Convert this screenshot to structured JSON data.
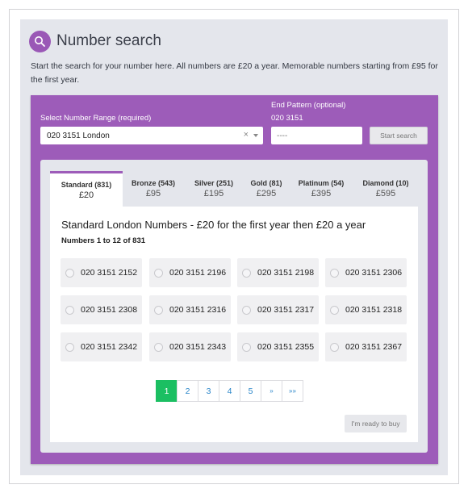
{
  "header": {
    "title": "Number search",
    "logo_icon": "magnifier-icon"
  },
  "intro": "Start the search for your number here. All numbers are £20 a year. Memorable numbers starting from £95 for the first year.",
  "search": {
    "range_label": "Select Number Range (required)",
    "range_value": "020 3151 London",
    "pattern_label": "End Pattern (optional)",
    "pattern_prefix": "020 3151",
    "pattern_placeholder": "----",
    "start_button": "Start search"
  },
  "tabs": [
    {
      "name": "Standard (831)",
      "price": "£20",
      "active": true
    },
    {
      "name": "Bronze (543)",
      "price": "£95"
    },
    {
      "name": "Silver (251)",
      "price": "£195"
    },
    {
      "name": "Gold (81)",
      "price": "£295"
    },
    {
      "name": "Platinum (54)",
      "price": "£395"
    },
    {
      "name": "Diamond (10)",
      "price": "£595"
    }
  ],
  "results": {
    "title": "Standard London Numbers - £20 for the first year then £20 a year",
    "subtitle": "Numbers 1 to 12 of 831",
    "numbers": [
      "020 3151 2152",
      "020 3151 2196",
      "020 3151 2198",
      "020 3151 2306",
      "020 3151 2308",
      "020 3151 2316",
      "020 3151 2317",
      "020 3151 2318",
      "020 3151 2342",
      "020 3151 2343",
      "020 3151 2355",
      "020 3151 2367"
    ]
  },
  "pagination": [
    "1",
    "2",
    "3",
    "4",
    "5",
    "»",
    "»»"
  ],
  "buy_button": "I'm ready to buy",
  "colors": {
    "accent": "#9d5cb9",
    "active_page": "#1bbf62",
    "link": "#2a86c9"
  }
}
